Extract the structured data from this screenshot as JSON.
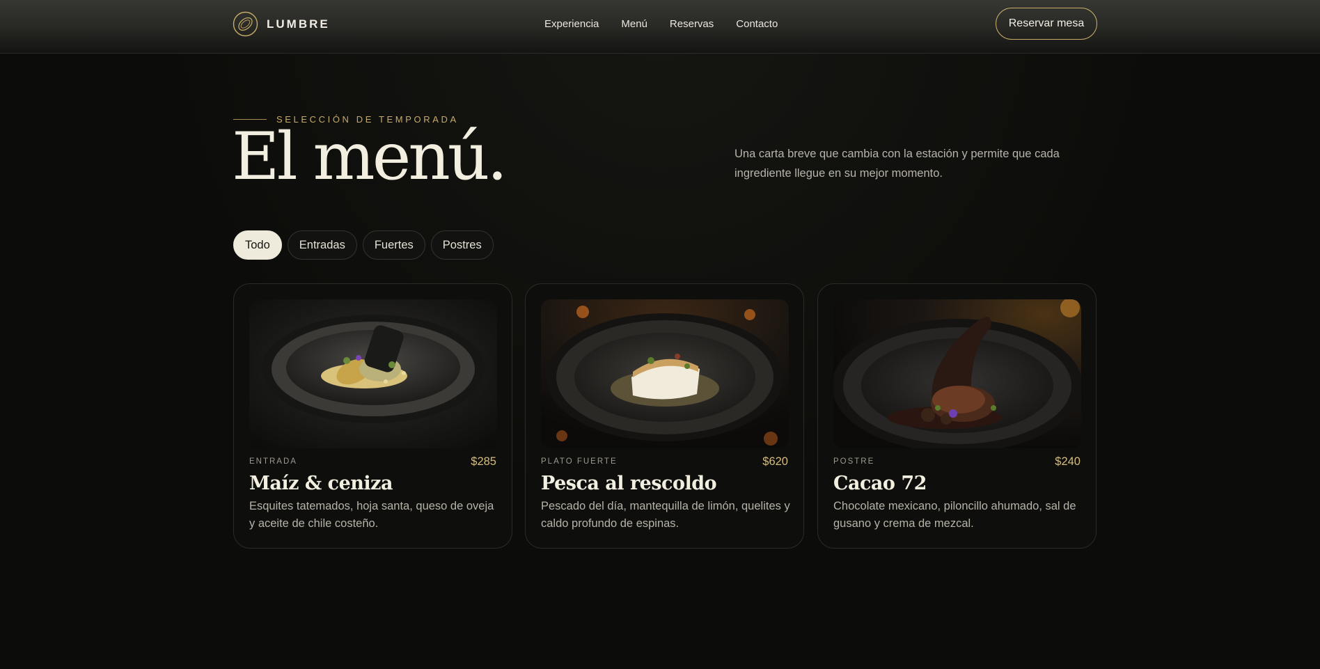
{
  "brand": {
    "name": "LUMBRE",
    "logo_icon": "ring-logo-icon"
  },
  "nav": {
    "items": [
      {
        "label": "Experiencia"
      },
      {
        "label": "Menú"
      },
      {
        "label": "Reservas"
      },
      {
        "label": "Contacto"
      }
    ],
    "cta_label": "Reservar mesa"
  },
  "hero": {
    "eyebrow": "SELECCIÓN DE TEMPORADA",
    "title": "El menú.",
    "description": "Una carta breve que cambia con la estación y permite que cada ingrediente llegue en su mejor momento."
  },
  "filters": {
    "active": "Todo",
    "items": [
      {
        "label": "Todo"
      },
      {
        "label": "Entradas"
      },
      {
        "label": "Fuertes"
      },
      {
        "label": "Postres"
      }
    ]
  },
  "cards": [
    {
      "category": "ENTRADA",
      "price": "$285",
      "title": "Maíz & ceniza",
      "description": "Esquites tatemados, hoja santa, queso de oveja y aceite de chile costeño."
    },
    {
      "category": "PLATO FUERTE",
      "price": "$620",
      "title": "Pesca al rescoldo",
      "description": "Pescado del día, mantequilla de limón, quelites y caldo profundo de espinas."
    },
    {
      "category": "POSTRE",
      "price": "$240",
      "title": "Cacao 72",
      "description": "Chocolate mexicano, piloncillo ahumado, sal de gusano y crema de mezcal."
    }
  ],
  "colors": {
    "background": "#0c0c0a",
    "accent_gold": "#c9ad6a",
    "price_gold": "#d6bd7d",
    "cream": "#efebdc"
  }
}
